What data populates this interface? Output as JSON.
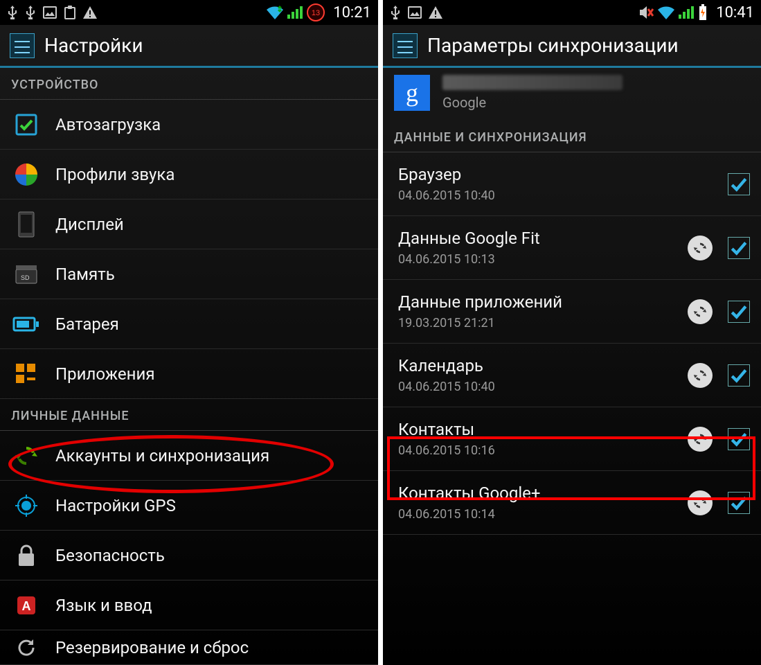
{
  "left": {
    "status_time": "10:21",
    "action_title": "Настройки",
    "section_device": "УСТРОЙСТВО",
    "section_personal": "ЛИЧНЫЕ ДАННЫЕ",
    "rows": {
      "autoload": "Автозагрузка",
      "sound": "Профили звука",
      "display": "Дисплей",
      "storage": "Память",
      "battery": "Батарея",
      "apps": "Приложения",
      "accounts": "Аккаунты и синхронизация",
      "gps": "Настройки GPS",
      "security": "Безопасность",
      "language": "Язык и ввод",
      "backup": "Резервирование и сброс"
    }
  },
  "right": {
    "status_time": "10:41",
    "action_title": "Параметры синхронизации",
    "account_provider": "Google",
    "section_sync": "ДАННЫЕ И СИНХРОНИЗАЦИЯ",
    "items": [
      {
        "title": "Браузер",
        "time": "04.06.2015 10:40",
        "has_refresh": false,
        "checked": true
      },
      {
        "title": "Данные Google Fit",
        "time": "04.06.2015 10:13",
        "has_refresh": true,
        "checked": true
      },
      {
        "title": "Данные приложений",
        "time": "19.03.2015 21:21",
        "has_refresh": true,
        "checked": true
      },
      {
        "title": "Календарь",
        "time": "04.06.2015 10:40",
        "has_refresh": true,
        "checked": true
      },
      {
        "title": "Контакты",
        "time": "04.06.2015 10:16",
        "has_refresh": true,
        "checked": true
      },
      {
        "title": "Контакты Google+",
        "time": "04.06.2015 10:14",
        "has_refresh": true,
        "checked": true
      }
    ]
  }
}
